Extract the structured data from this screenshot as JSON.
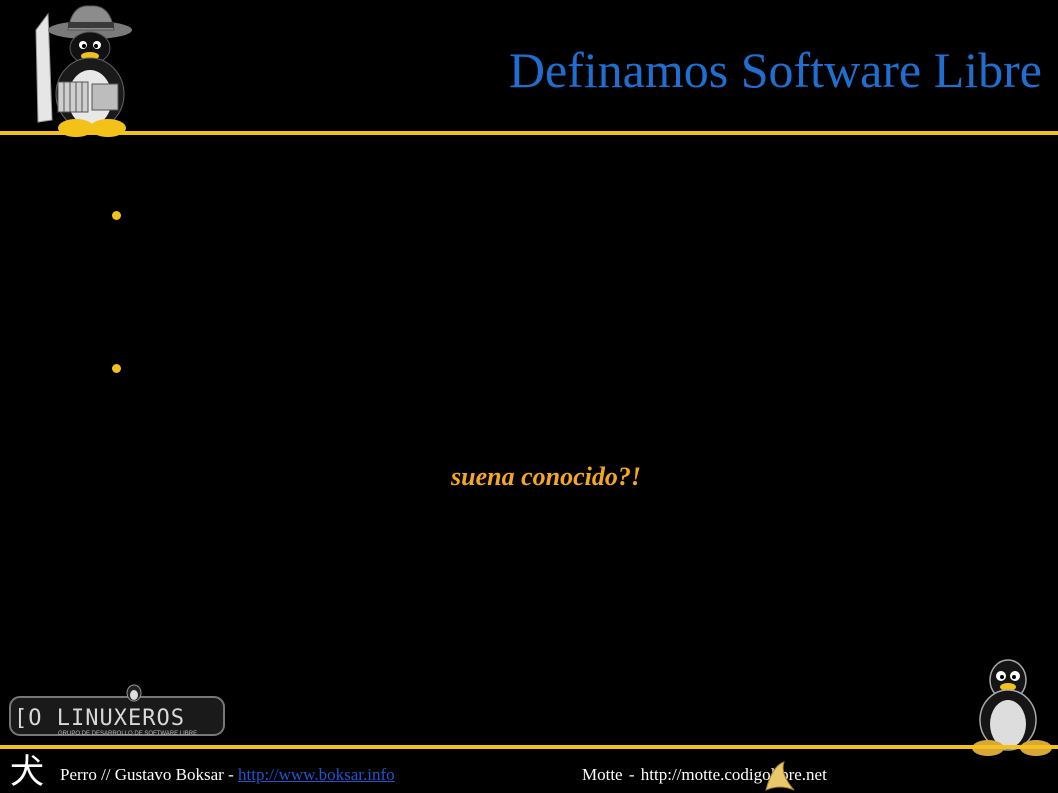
{
  "slide": {
    "title": "Definamos Software Libre",
    "bullets": [
      "",
      ""
    ],
    "tagline": "suena conocido?!"
  },
  "logo": {
    "brand_text": "[O LINUXEROS",
    "sub_text": "GRUPO DE DESARROLLO DE SOFTWARE LIBRE"
  },
  "footer": {
    "glyph": "犬",
    "author_prefix": "Perro // Gustavo Boksar - ",
    "author_link": "http://www.boksar.info",
    "right_name": "Motte",
    "right_sep": "-",
    "right_url": "http://motte.codigolibre.net"
  },
  "colors": {
    "background": "#000000",
    "title": "#1f6fd1",
    "accent_rule": "#f2c21b",
    "tagline": "#f5a623",
    "link": "#2255cc"
  },
  "icons": [
    "penguin-hat-icon",
    "penguin-icon",
    "banana-icon",
    "linuxeros-logo"
  ]
}
